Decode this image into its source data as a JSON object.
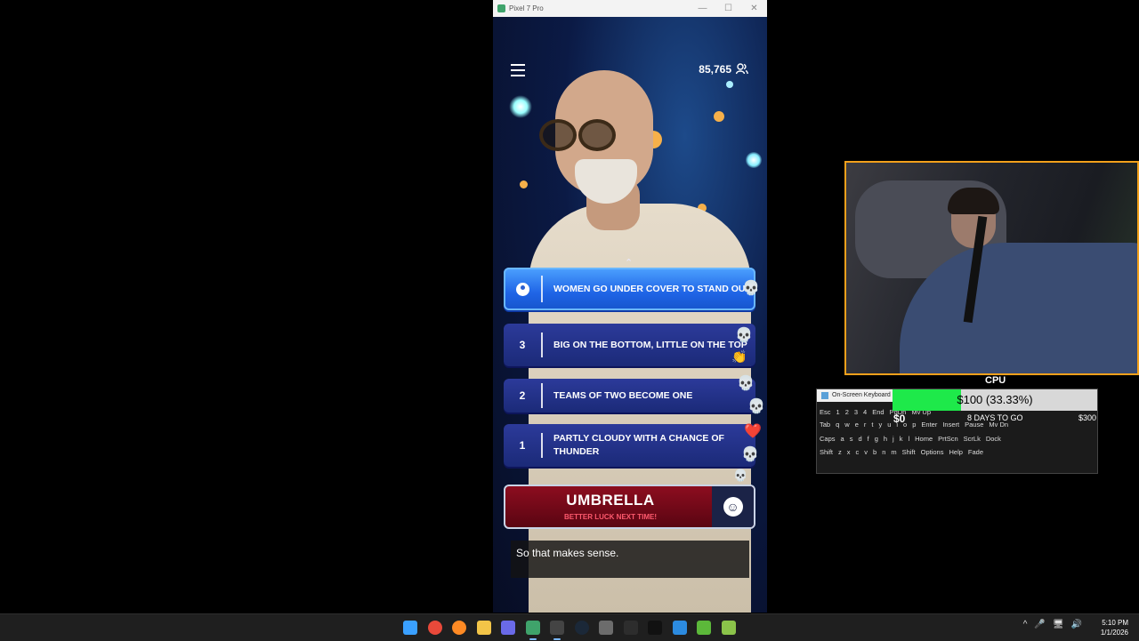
{
  "emulator": {
    "window_title": "Pixel 7 Pro",
    "controls": {
      "minimize": "—",
      "maximize": "☐",
      "close": "✕"
    }
  },
  "game": {
    "viewer_count": "85,765",
    "scroll_hint": "⌃",
    "answers": [
      {
        "rank": "",
        "text": "WOMEN GO UNDER COVER TO STAND OUT",
        "highlighted": true,
        "reactions": [
          "💀"
        ]
      },
      {
        "rank": "3",
        "text": "BIG ON THE BOTTOM, LITTLE ON THE TOP",
        "highlighted": false,
        "reactions": [
          "💀",
          "👏"
        ]
      },
      {
        "rank": "2",
        "text": "TEAMS OF TWO BECOME ONE",
        "highlighted": false,
        "reactions": [
          "💀",
          "💀"
        ]
      },
      {
        "rank": "1",
        "text": "PARTLY CLOUDY WITH A CHANCE OF THUNDER",
        "highlighted": false,
        "reactions": [
          "❤️",
          "💀",
          "💀"
        ]
      }
    ],
    "final_answer": "UMBRELLA",
    "final_result": "BETTER LUCK NEXT TIME!",
    "caption": "So that makes sense."
  },
  "overlay": {
    "cpu_label": "CPU",
    "keyboard_title": "On-Screen Keyboard",
    "progress_text": "$100 (33.33%)",
    "progress_fraction": 0.3333,
    "progress_min": "$0",
    "progress_countdown": "8 DAYS TO GO",
    "progress_max": "$300",
    "key_rows": [
      [
        "Esc",
        "1",
        "2",
        "3",
        "4",
        "End",
        "PgDn",
        "Mv Up"
      ],
      [
        "Tab",
        "q",
        "w",
        "e",
        "r",
        "t",
        "y",
        "u",
        "i",
        "o",
        "p",
        "Enter",
        "Insert",
        "Pause",
        "Mv Dn"
      ],
      [
        "Caps",
        "a",
        "s",
        "d",
        "f",
        "g",
        "h",
        "j",
        "k",
        "l",
        "Home",
        "PrtScn",
        "ScrLk",
        "Dock"
      ],
      [
        "Shift",
        "z",
        "x",
        "c",
        "v",
        "b",
        "n",
        "m",
        "Shift",
        "Options",
        "Help",
        "Fade"
      ]
    ]
  },
  "taskbar": {
    "icons": [
      "windows-start",
      "chrome",
      "firefox",
      "file-explorer",
      "media-player",
      "android-emulator",
      "obs",
      "steam",
      "calculator",
      "terminal",
      "capcut",
      "ccleaner",
      "tracker",
      "app"
    ],
    "tray": [
      "^",
      "🎤",
      "🖥",
      "🔊"
    ],
    "time": "5:10 PM",
    "date": "1/1/2026"
  }
}
